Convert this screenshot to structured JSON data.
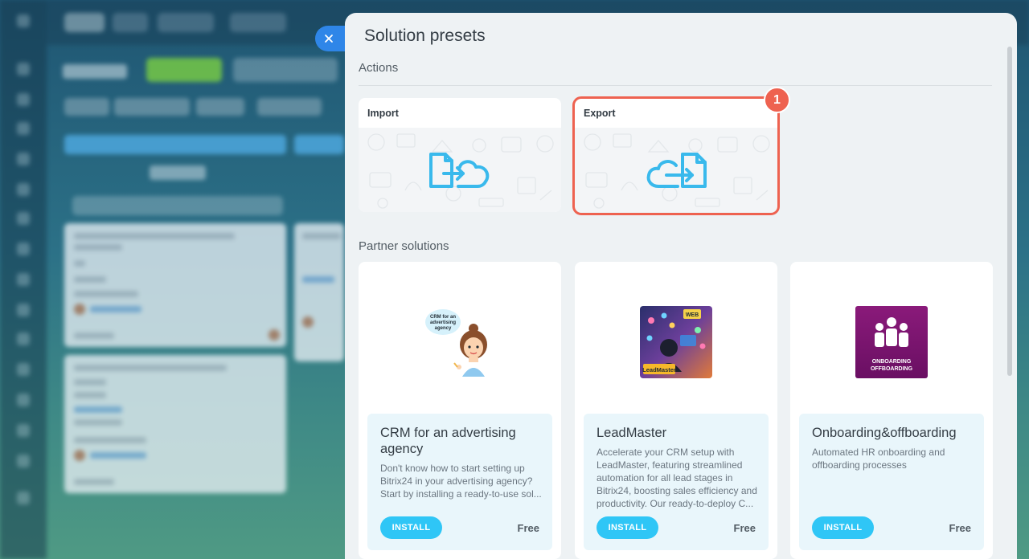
{
  "panel": {
    "title": "Solution presets"
  },
  "actions": {
    "section_title": "Actions",
    "items": [
      {
        "label": "Import",
        "icon": "import-cloud-icon"
      },
      {
        "label": "Export",
        "icon": "export-cloud-icon"
      }
    ],
    "highlight_badge": "1"
  },
  "partners": {
    "section_title": "Partner solutions",
    "items": [
      {
        "name": "CRM for an advertising agency",
        "image_caption": "CRM for an advertising agency",
        "description": "Don't know how to start setting up Bitrix24 in your advertising agency? Start by installing a ready-to-use sol...",
        "install_label": "INSTALL",
        "price": "Free"
      },
      {
        "name": "LeadMaster",
        "image_caption": "LeadMaster",
        "image_caption_2": "WEB",
        "description": "Accelerate your CRM setup with LeadMaster, featuring streamlined automation for all lead stages in Bitrix24, boosting sales efficiency and productivity. Our ready-to-deploy C...",
        "install_label": "INSTALL",
        "price": "Free"
      },
      {
        "name": "Onboarding&offboarding",
        "image_caption": "ONBOARDING",
        "image_caption_2": "OFFBOARDING",
        "description": "Automated HR onboarding and offboarding processes",
        "install_label": "INSTALL",
        "price": "Free"
      }
    ]
  },
  "colors": {
    "highlight": "#ee6250",
    "install_button": "#2fc6f6",
    "close_button": "#2f86e8"
  }
}
